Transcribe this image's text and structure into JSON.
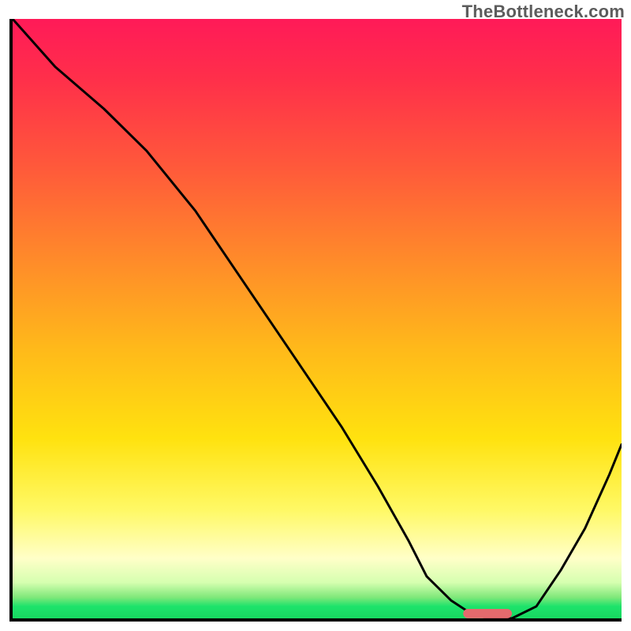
{
  "watermark": "TheBottleneck.com",
  "colors": {
    "curve": "#000000",
    "marker": "#e46a6d",
    "axis": "#000000"
  },
  "chart_data": {
    "type": "line",
    "title": "",
    "xlabel": "",
    "ylabel": "",
    "xlim": [
      0,
      100
    ],
    "ylim": [
      0,
      100
    ],
    "grid": false,
    "series": [
      {
        "name": "bottleneck-curve",
        "x": [
          0,
          7,
          15,
          22,
          30,
          38,
          46,
          54,
          60,
          65,
          68,
          72,
          75,
          78,
          82,
          86,
          90,
          94,
          98,
          100
        ],
        "values": [
          100,
          92,
          85,
          78,
          68,
          56,
          44,
          32,
          22,
          13,
          7,
          3,
          1,
          0,
          0,
          2,
          8,
          15,
          24,
          29
        ]
      }
    ],
    "marker": {
      "name": "optimal-range",
      "x_start": 74,
      "x_end": 82,
      "y": 0.8
    },
    "background_gradient_stops": [
      {
        "pos": 0.0,
        "color": "#ff1a58"
      },
      {
        "pos": 0.1,
        "color": "#ff2f4a"
      },
      {
        "pos": 0.25,
        "color": "#ff5a3a"
      },
      {
        "pos": 0.4,
        "color": "#ff8a2a"
      },
      {
        "pos": 0.55,
        "color": "#ffb91a"
      },
      {
        "pos": 0.7,
        "color": "#ffe20f"
      },
      {
        "pos": 0.82,
        "color": "#fff966"
      },
      {
        "pos": 0.9,
        "color": "#ffffc8"
      },
      {
        "pos": 0.94,
        "color": "#d6ffb0"
      },
      {
        "pos": 0.965,
        "color": "#7fe87a"
      },
      {
        "pos": 0.98,
        "color": "#1de36b"
      },
      {
        "pos": 1.0,
        "color": "#18d860"
      }
    ]
  }
}
